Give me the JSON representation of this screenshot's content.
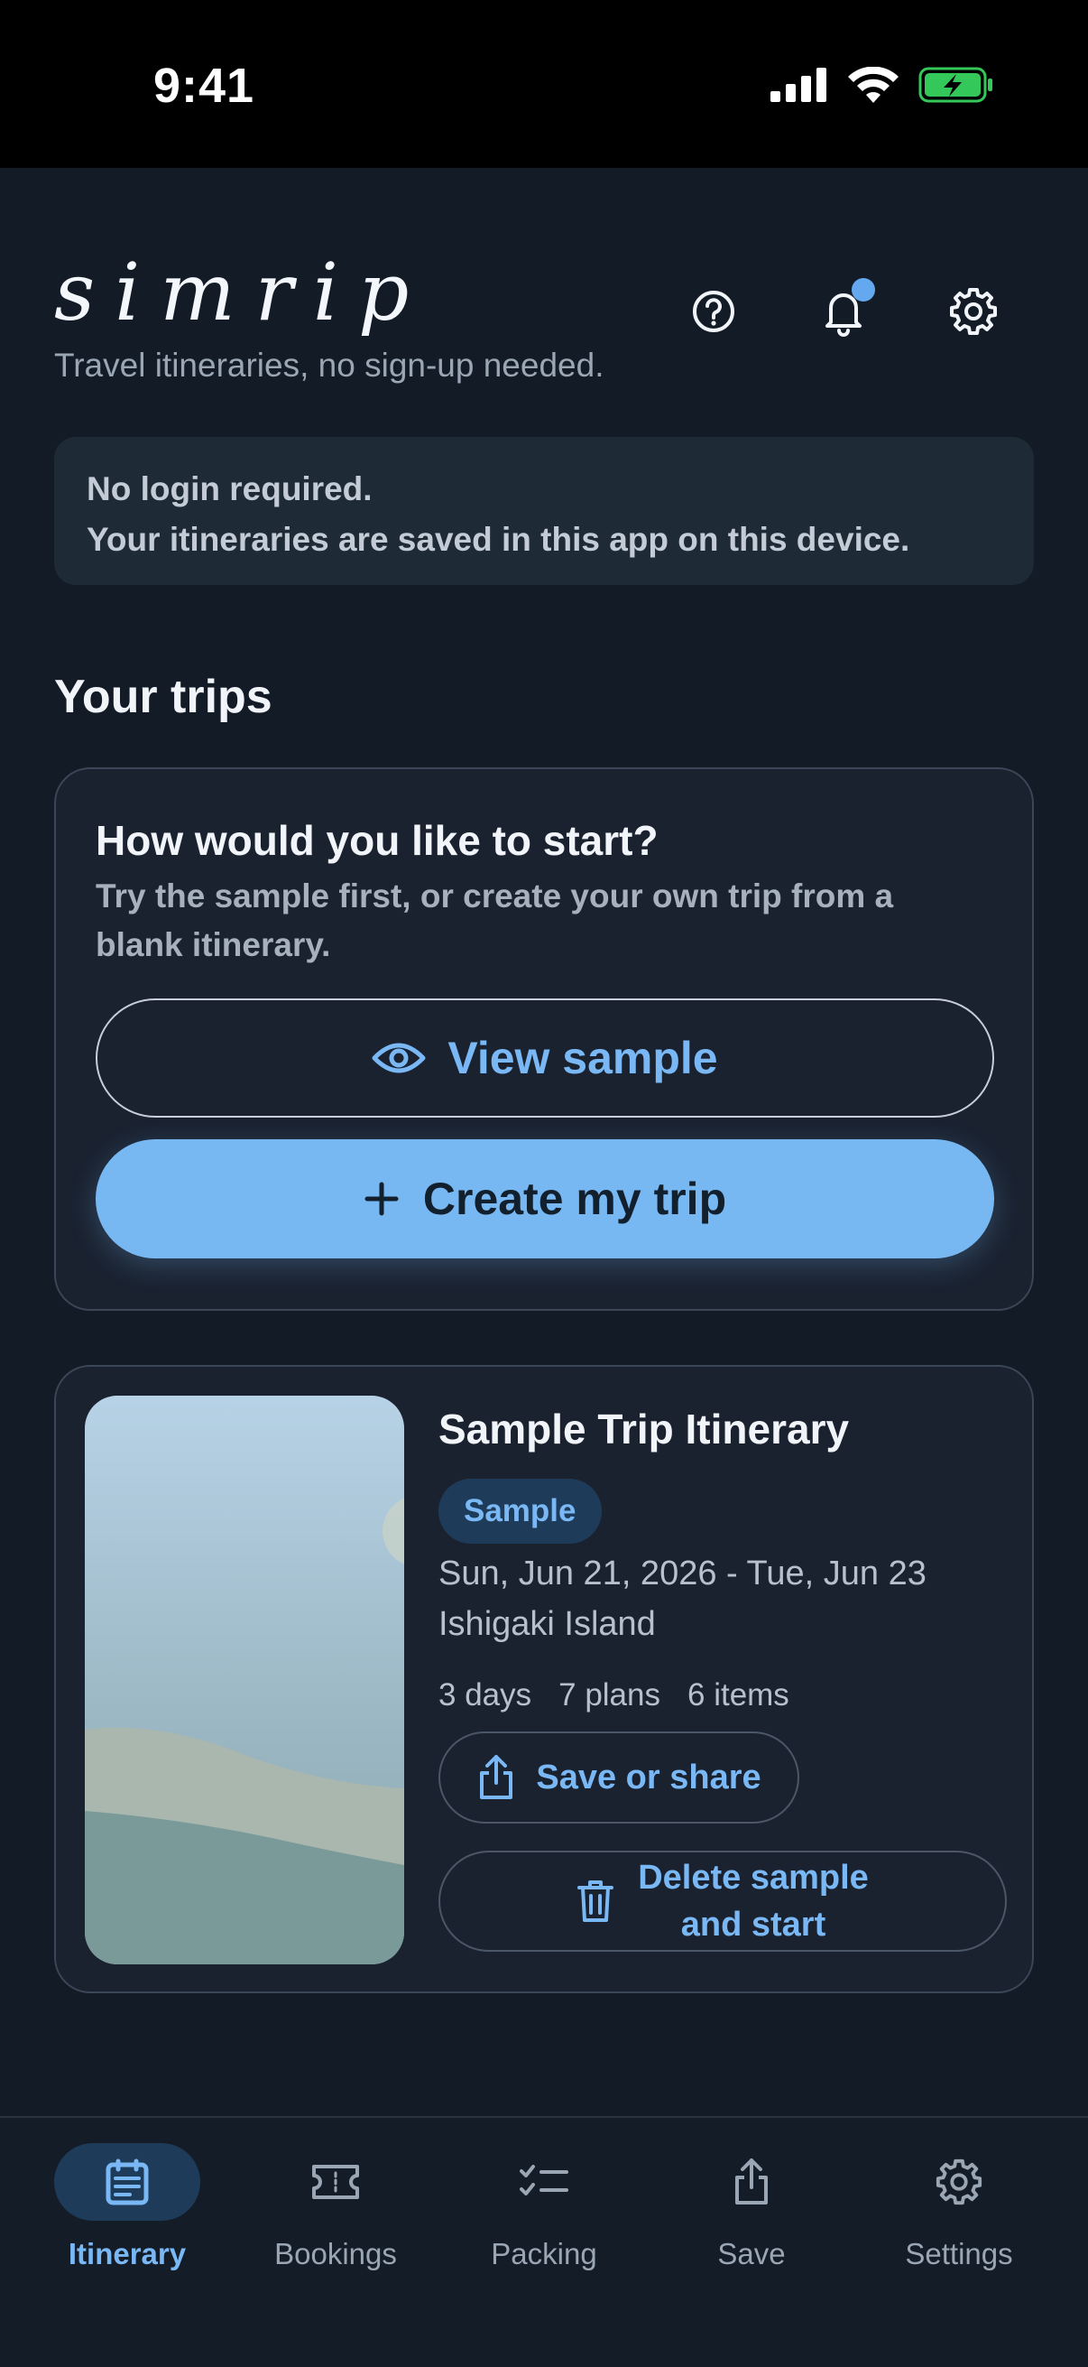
{
  "status_bar": {
    "time": "9:41"
  },
  "header": {
    "logo": "simrip",
    "tagline": "Travel itineraries, no sign-up needed."
  },
  "notice": {
    "line1": "No login required.",
    "line2": "Your itineraries are saved in this app on this device."
  },
  "trips": {
    "section_title": "Your trips"
  },
  "start_card": {
    "title": "How would you like to start?",
    "description": "Try the sample first, or create your own trip from a blank itinerary.",
    "view_sample_label": "View sample",
    "create_trip_label": "Create my trip"
  },
  "trip_card": {
    "title": "Sample Trip Itinerary",
    "badge": "Sample",
    "dates": "Sun, Jun 21, 2026 - Tue, Jun 23",
    "place": "Ishigaki Island",
    "stats": {
      "days": "3 days",
      "plans": "7 plans",
      "items": "6 items"
    },
    "share_label": "Save or share",
    "delete_label_line1": "Delete sample",
    "delete_label_line2": "and start"
  },
  "tabbar": {
    "items": [
      {
        "label": "Itinerary",
        "icon": "calendar-icon",
        "active": true
      },
      {
        "label": "Bookings",
        "icon": "ticket-icon",
        "active": false
      },
      {
        "label": "Packing",
        "icon": "checklist-icon",
        "active": false
      },
      {
        "label": "Save",
        "icon": "share-icon",
        "active": false
      },
      {
        "label": "Settings",
        "icon": "gear-icon",
        "active": false
      }
    ]
  },
  "colors": {
    "background": "#131b26",
    "accent": "#78b8f2",
    "card": "#1a2230",
    "notification_dot": "#64a9ef",
    "battery": "#34c759"
  }
}
